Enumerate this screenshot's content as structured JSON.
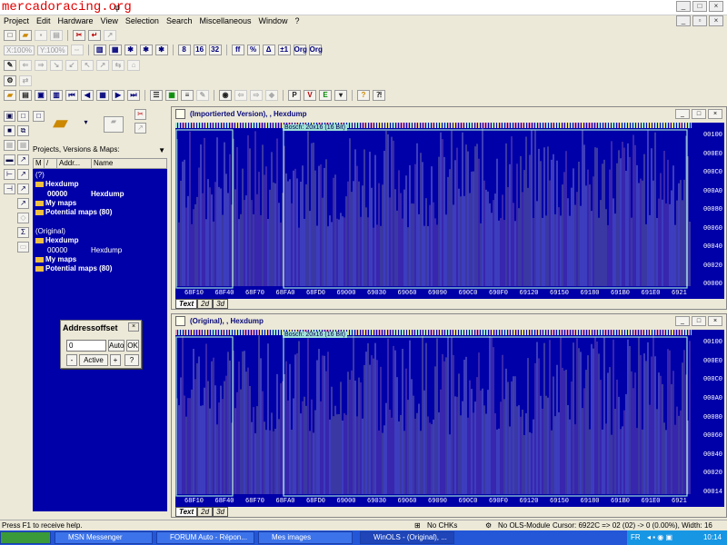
{
  "watermark": "mercadoracing.org",
  "watermark_suffix": "φ",
  "menu": [
    "Project",
    "Edit",
    "Hardware",
    "View",
    "Selection",
    "Search",
    "Miscellaneous",
    "Window",
    "?"
  ],
  "toolbar": {
    "x_field": "X:100%",
    "y_field": "Y:100%",
    "buttons_row1": [
      "new",
      "open",
      "save",
      "print",
      "find",
      "import"
    ],
    "buttons_row2": [
      "hex",
      "map",
      "8",
      "16",
      "32",
      "ff",
      "%",
      "Δ",
      "±1",
      "Org",
      "Org"
    ],
    "buttons_row4": [
      "first",
      "prev",
      "grid",
      "next",
      "last",
      "list",
      "table",
      "print",
      "find",
      "nav",
      "nav",
      "P",
      "V",
      "E",
      "?",
      "help"
    ]
  },
  "left_panel": {
    "title": "Projects, Versions & Maps:",
    "columns": [
      "M",
      "/",
      "Addr...",
      "Name"
    ],
    "tree": [
      {
        "label": "(?)",
        "indent": 0,
        "bold": false,
        "folder": false
      },
      {
        "label": "Hexdump",
        "indent": 0,
        "bold": true,
        "folder": true
      },
      {
        "label": "00000",
        "name": "Hexdump",
        "indent": 1,
        "bold": true,
        "folder": false
      },
      {
        "label": "My maps",
        "indent": 0,
        "bold": true,
        "folder": true
      },
      {
        "label": "Potential maps (80)",
        "indent": 0,
        "bold": true,
        "folder": true
      },
      {
        "label": "(Original)",
        "indent": 0,
        "bold": false,
        "folder": false
      },
      {
        "label": "Hexdump",
        "indent": 0,
        "bold": true,
        "folder": true
      },
      {
        "label": "00000",
        "name": "Hexdump",
        "indent": 1,
        "bold": false,
        "folder": false
      },
      {
        "label": "My maps",
        "indent": 0,
        "bold": true,
        "folder": true
      },
      {
        "label": "Potential maps (80)",
        "indent": 0,
        "bold": true,
        "folder": true
      }
    ]
  },
  "addr_dialog": {
    "title": "Addressoffset",
    "value": "0",
    "auto_label": "Auto",
    "ok_label": "OK",
    "minus_label": "-",
    "active_label": "Active",
    "plus_label": "+",
    "help_label": "?"
  },
  "windows": [
    {
      "title": "(Importierted Version), , Hexdump",
      "selection_label": "Bosch: 20x16 (16 Bit)",
      "y_labels": [
        "00100",
        "000E0",
        "000C0",
        "000A0",
        "00080",
        "00060",
        "00040",
        "00020",
        "00000"
      ],
      "x_labels": [
        "68F10",
        "68F40",
        "68F70",
        "68FA0",
        "68FD0",
        "69000",
        "69030",
        "69060",
        "69090",
        "690C0",
        "690F0",
        "69120",
        "69150",
        "69180",
        "691B0",
        "691E0",
        "6921"
      ],
      "tabs": [
        "Text",
        "2d",
        "3d"
      ],
      "active_tab": "Text"
    },
    {
      "title": "(Original), , Hexdump",
      "selection_label": "Bosch: 20x16 (16 Bit)",
      "y_labels": [
        "00100",
        "000E0",
        "000C0",
        "000A0",
        "00080",
        "00060",
        "00040",
        "00020",
        "00014"
      ],
      "x_labels": [
        "68F10",
        "68F40",
        "68F70",
        "68FA0",
        "68FD0",
        "69000",
        "69030",
        "69060",
        "69090",
        "690C0",
        "690F0",
        "69120",
        "69150",
        "69180",
        "691B0",
        "691E0",
        "6921"
      ],
      "tabs": [
        "Text",
        "2d",
        "3d"
      ],
      "active_tab": "Text"
    }
  ],
  "status": {
    "help": "Press F1 to receive help.",
    "chks": "No CHKs",
    "module": "No OLS-Module",
    "cursor": "Cursor: 6922C => 02 (02) -> 0 (0.00%), Width: 16"
  },
  "taskbar": {
    "tasks": [
      "MSN Messenger",
      "FORUM Auto - Répon...",
      "Mes images",
      "WinOLS - (Original), ..."
    ],
    "tray_lang": "FR",
    "clock": "10:14"
  },
  "colors": {
    "canvas": "#0000a8",
    "trace_white": "#e8e8ff",
    "trace_pink": "#d890c0",
    "trace_yellow": "#e0d890",
    "selection": "#9fe0d8"
  }
}
